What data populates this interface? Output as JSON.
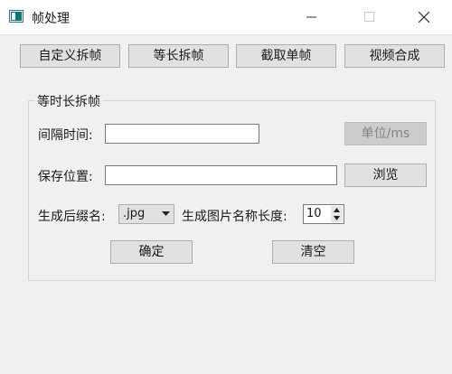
{
  "window": {
    "title": "帧处理",
    "controls": [
      "minimize",
      "maximize",
      "close"
    ]
  },
  "tabs": [
    {
      "label": "自定义拆帧"
    },
    {
      "label": "等长拆帧"
    },
    {
      "label": "截取单帧"
    },
    {
      "label": "视频合成"
    }
  ],
  "group": {
    "title": "等时长拆帧",
    "interval_label": "间隔时间:",
    "interval_value": "",
    "unit_button": "单位/ms",
    "save_label": "保存位置:",
    "save_value": "",
    "browse_button": "浏览",
    "suffix_label": "生成后缀名:",
    "suffix_selected": ".jpg",
    "name_length_label": "生成图片名称长度:",
    "name_length_value": "10",
    "ok_button": "确定",
    "clear_button": "清空"
  },
  "colors": {
    "button_bg": "#e1e1e1",
    "button_border": "#adadad",
    "disabled_bg": "#cccccc",
    "disabled_text": "#838383"
  }
}
